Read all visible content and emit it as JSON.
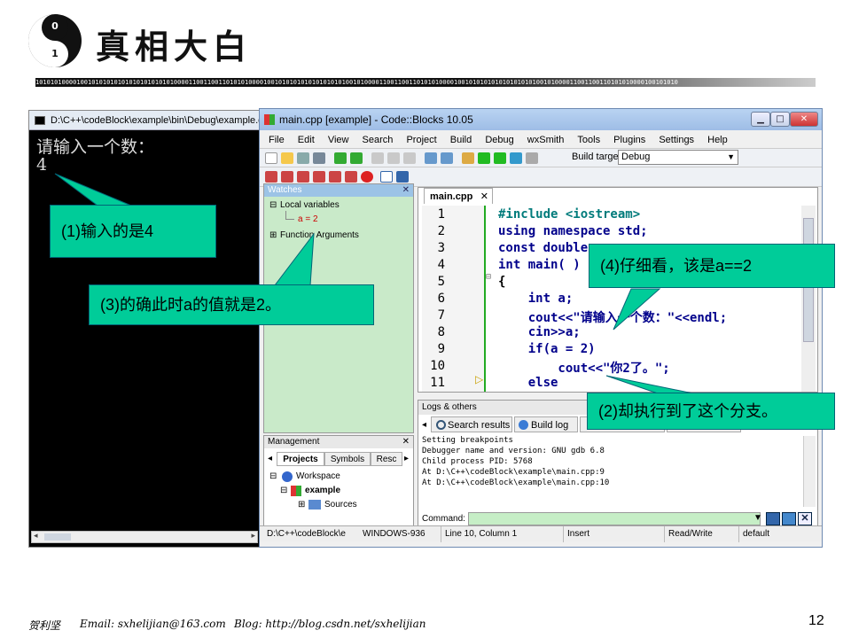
{
  "slide": {
    "title": "真相大白",
    "logo_top": "0",
    "logo_bottom": "1",
    "binary_strip": "1010101000010010101010101010101010101000011001100110101010000100101010101010101010100101000011001100110101010000100101010101010101010100101000011001100110101010000100101010"
  },
  "console": {
    "title": "D:\\C++\\codeBlock\\example\\bin\\Debug\\example.exe",
    "prompt": "请输入一个数：",
    "input": "4"
  },
  "codeblocks": {
    "title": "main.cpp [example] - Code::Blocks 10.05",
    "menu": [
      "File",
      "Edit",
      "View",
      "Search",
      "Project",
      "Build",
      "Debug",
      "wxSmith",
      "Tools",
      "Plugins",
      "Settings",
      "Help"
    ],
    "build_target_label": "Build target:",
    "build_target_value": "Debug",
    "watches": {
      "header": "Watches",
      "local_variables": "Local variables",
      "a_value": "a = 2",
      "function_arguments": "Function Arguments"
    },
    "management": {
      "header": "Management",
      "tabs": [
        "Projects",
        "Symbols",
        "Resc"
      ],
      "workspace": "Workspace",
      "project": "example",
      "sources": "Sources"
    },
    "editor": {
      "tab": "main.cpp",
      "lines": [
        {
          "n": "1",
          "code": "#include <iostream>"
        },
        {
          "n": "2",
          "code": "using namespace std;"
        },
        {
          "n": "3",
          "code": "const double"
        },
        {
          "n": "4",
          "code": "int main( )"
        },
        {
          "n": "5",
          "code": "{"
        },
        {
          "n": "6",
          "code": "    int a;"
        },
        {
          "n": "7",
          "code": "    cout<<\"请输入一个数：\"<<endl;"
        },
        {
          "n": "8",
          "code": "    cin>>a;"
        },
        {
          "n": "9",
          "code": "    if(a = 2)"
        },
        {
          "n": "10",
          "code": "        cout<<\"你2了。\";"
        },
        {
          "n": "11",
          "code": "    else"
        }
      ]
    },
    "logs": {
      "header": "Logs & others",
      "tabs": [
        "Search results",
        "Build log"
      ],
      "lines": [
        "Setting breakpoints",
        "Debugger name and version: GNU gdb 6.8",
        "Child process PID: 5768",
        "At D:\\C++\\codeBlock\\example\\main.cpp:9",
        "At D:\\C++\\codeBlock\\example\\main.cpp:10"
      ],
      "command_label": "Command:"
    },
    "status": {
      "path": "D:\\C++\\codeBlock\\e",
      "encoding": "WINDOWS-936",
      "position": "Line 10, Column 1",
      "mode": "Insert",
      "access": "Read/Write",
      "profile": "default"
    }
  },
  "callouts": {
    "c1": "(1)输入的是4",
    "c2": "(2)却执行到了这个分支。",
    "c3": "(3)的确此时a的值就是2。",
    "c4": "(4)仔细看，该是a==2"
  },
  "footer": {
    "author": "贺利坚",
    "email": "Email:  sxhelijian@163.com",
    "blog": "Blog:  http://blog.csdn.net/sxhelijian",
    "page": "12"
  },
  "colors": {
    "callout": "#00cc99",
    "keyword": "#0000aa",
    "string": "#0000ff",
    "number": "#ff0000"
  }
}
